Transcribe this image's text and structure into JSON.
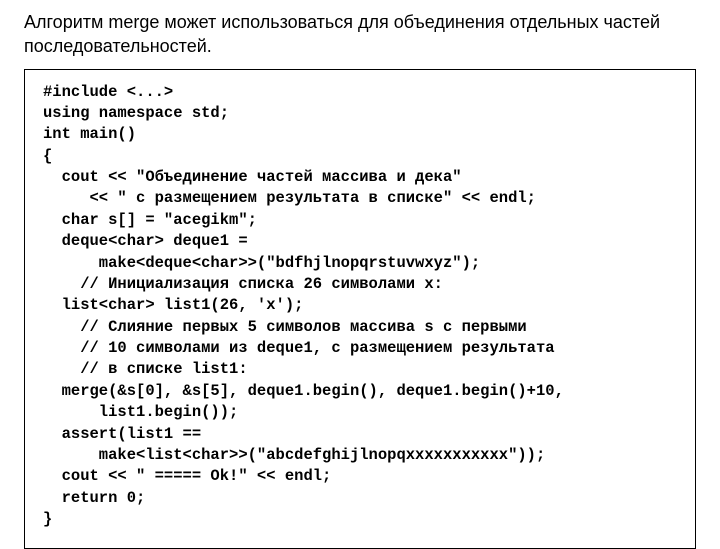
{
  "intro": "Алгоритм merge может использоваться для объединения отдельных частей последовательностей.",
  "code": "#include <...>\nusing namespace std;\nint main()\n{\n  cout << \"Объединение частей массива и дека\"\n     << \" с размещением результата в списке\" << endl;\n  char s[] = \"acegikm\";\n  deque<char> deque1 =\n      make<deque<char>>(\"bdfhjlnopqrstuvwxyz\");\n    // Инициализация списка 26 символами x:\n  list<char> list1(26, 'x');\n    // Слияние первых 5 символов массива s с первыми\n    // 10 символами из deque1, с размещением результата\n    // в списке list1:\n  merge(&s[0], &s[5], deque1.begin(), deque1.begin()+10,\n      list1.begin());\n  assert(list1 ==\n      make<list<char>>(\"abcdefghijlnopqxxxxxxxxxxx\"));\n  cout << \" ===== Ok!\" << endl;\n  return 0;\n}"
}
